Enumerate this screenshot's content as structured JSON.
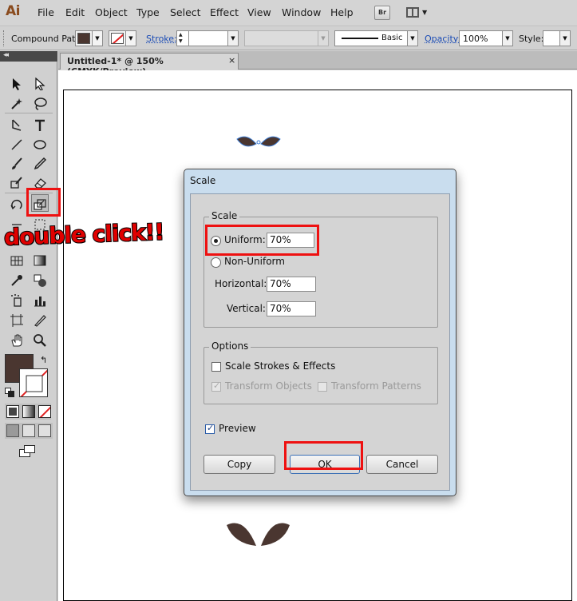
{
  "app": {
    "logo": "Ai",
    "menu": [
      "File",
      "Edit",
      "Object",
      "Type",
      "Select",
      "Effect",
      "View",
      "Window",
      "Help"
    ],
    "bridge_label": "Br"
  },
  "controlbar": {
    "selection_label": "Compound Path",
    "fill_color": "#4a3630",
    "stroke_label": "Stroke:",
    "brush_style_label": "Basic",
    "opacity_label": "Opacity:",
    "opacity_value": "100%",
    "style_label": "Style:"
  },
  "document": {
    "tab_title": "Untitled-1* @ 150% (CMYK/Preview)",
    "close_glyph": "×",
    "shape_color": "#4a3630"
  },
  "tools": {
    "fill_color": "#4a3630",
    "highlighted_tool": "scale-tool"
  },
  "annotation": {
    "text": "double click!!"
  },
  "dialog": {
    "title": "Scale",
    "scale_group_label": "Scale",
    "uniform_label": "Uniform:",
    "uniform_value": "70%",
    "uniform_selected": true,
    "non_uniform_label": "Non-Uniform",
    "horizontal_label": "Horizontal:",
    "horizontal_value": "70%",
    "vertical_label": "Vertical:",
    "vertical_value": "70%",
    "options_group_label": "Options",
    "scale_strokes_label": "Scale Strokes & Effects",
    "scale_strokes_checked": false,
    "transform_objects_label": "Transform Objects",
    "transform_objects_checked": true,
    "transform_patterns_label": "Transform Patterns",
    "transform_patterns_checked": false,
    "preview_label": "Preview",
    "preview_checked": true,
    "copy_label": "Copy",
    "ok_label": "OK",
    "cancel_label": "Cancel"
  },
  "colors": {
    "highlight": "#ee1111",
    "link_blue": "#1a4bb5"
  }
}
